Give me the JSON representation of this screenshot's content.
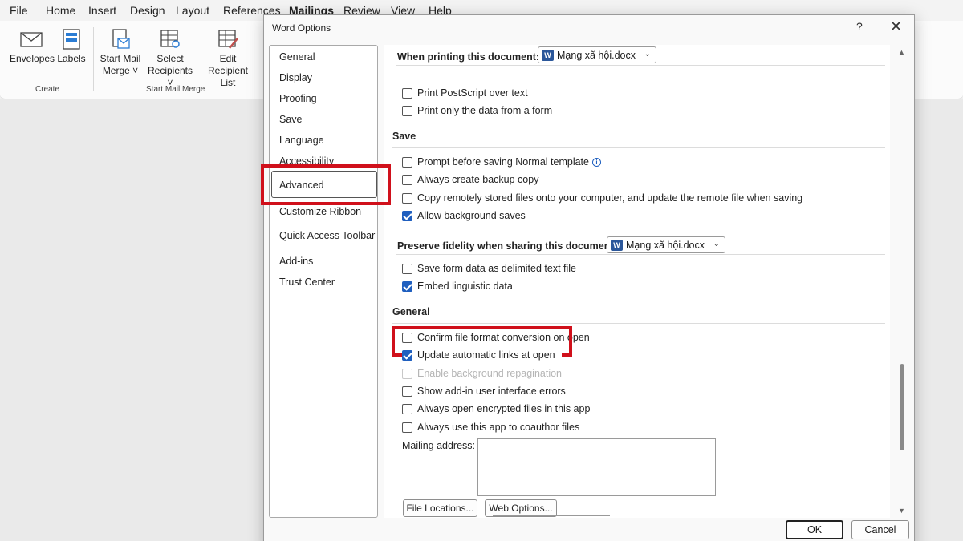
{
  "menu": [
    "File",
    "Home",
    "Insert",
    "Design",
    "Layout",
    "References",
    "Mailings",
    "Review",
    "View",
    "Help"
  ],
  "ribbon": {
    "envelopes": "Envelopes",
    "labels": "Labels",
    "start_mail_merge_1": "Start Mail",
    "start_mail_merge_2": "Merge ˅",
    "select_recipients_1": "Select",
    "select_recipients_2": "Recipients ˅",
    "edit_recipient_1": "Edit",
    "edit_recipient_2": "Recipient List",
    "group_create": "Create",
    "group_start_mail_merge": "Start Mail Merge"
  },
  "dialog": {
    "title": "Word Options",
    "help": "?",
    "close": "✕"
  },
  "nav": {
    "items": [
      "General",
      "Display",
      "Proofing",
      "Save",
      "Language",
      "Accessibility",
      "Advanced",
      "Customize Ribbon",
      "Quick Access Toolbar",
      "Add-ins",
      "Trust Center"
    ],
    "selected": "Advanced"
  },
  "content": {
    "printing_label": "When printing this document:",
    "printing_doc": "Mạng xã hội.docx",
    "print_postscript": "Print PostScript over text",
    "print_data_only": "Print only the data from a form",
    "save_title": "Save",
    "prompt_normal": "Prompt before saving Normal template",
    "backup_copy": "Always create backup copy",
    "copy_remote": "Copy remotely stored files onto your computer, and update the remote file when saving",
    "background_saves": "Allow background saves",
    "fidelity_label": "Preserve fidelity when sharing this document:",
    "fidelity_doc": "Mạng xã hội.docx",
    "save_form_data": "Save form data as delimited text file",
    "embed_linguistic": "Embed linguistic data",
    "general_title": "General",
    "confirm_conversion": "Confirm file format conversion on open",
    "update_links": "Update automatic links at open",
    "background_repagination": "Enable background repagination",
    "addin_errors": "Show add-in user interface errors",
    "open_encrypted": "Always open encrypted files in this app",
    "coauthor": "Always use this app to coauthor files",
    "mailing_address": "Mailing address:",
    "file_locations": "File Locations...",
    "web_options": "Web Options..."
  },
  "checks": {
    "print_postscript": false,
    "print_data_only": false,
    "prompt_normal": false,
    "backup_copy": false,
    "copy_remote": false,
    "background_saves": true,
    "save_form_data": false,
    "embed_linguistic": true,
    "confirm_conversion": false,
    "update_links": true,
    "background_repagination": false,
    "addin_errors": false,
    "open_encrypted": false,
    "coauthor": false
  },
  "footer": {
    "ok": "OK",
    "cancel": "Cancel"
  },
  "colors": {
    "highlight": "#d0101b",
    "check_accent": "#1f5fbf"
  }
}
